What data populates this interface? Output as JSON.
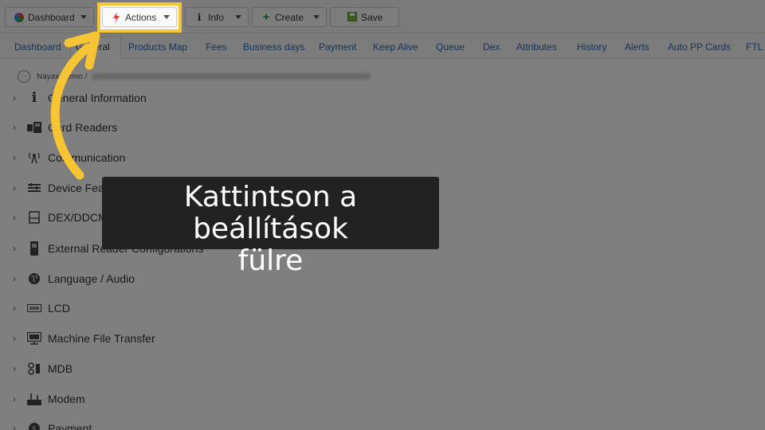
{
  "toolbar": {
    "dashboard_label": "Dashboard",
    "actions_label": "Actions",
    "info_label": "Info",
    "create_label": "Create",
    "save_label": "Save"
  },
  "tabs": [
    "Dashboard",
    "General",
    "Products Map",
    "Fees",
    "Business days",
    "Payment",
    "Keep Alive",
    "Queue",
    "Dex",
    "Attributes",
    "History",
    "Alerts",
    "Auto PP Cards",
    "FTL"
  ],
  "breadcrumb": {
    "root": "Nayax Demo /"
  },
  "tree": [
    {
      "label": "General Information",
      "icon": "info-icon"
    },
    {
      "label": "Card Readers",
      "icon": "card-reader-icon"
    },
    {
      "label": "Communication",
      "icon": "antenna-icon"
    },
    {
      "label": "Device Features",
      "icon": "features-icon"
    },
    {
      "label": "DEX/DDCMP",
      "icon": "document-icon"
    },
    {
      "label": "External Reader Configurations",
      "icon": "external-reader-icon"
    },
    {
      "label": "Language / Audio",
      "icon": "globe-icon"
    },
    {
      "label": "LCD",
      "icon": "lcd-icon"
    },
    {
      "label": "Machine File Transfer",
      "icon": "file-transfer-icon"
    },
    {
      "label": "MDB",
      "icon": "mdb-icon"
    },
    {
      "label": "Modem",
      "icon": "modem-icon"
    },
    {
      "label": "Payment",
      "icon": "payment-icon"
    }
  ],
  "caption": {
    "line1": "Kattintson a beállítások",
    "line2": "fülre"
  },
  "colors": {
    "highlight": "#f7c533",
    "link": "#2a6ebb",
    "caption_bg": "#222222"
  }
}
